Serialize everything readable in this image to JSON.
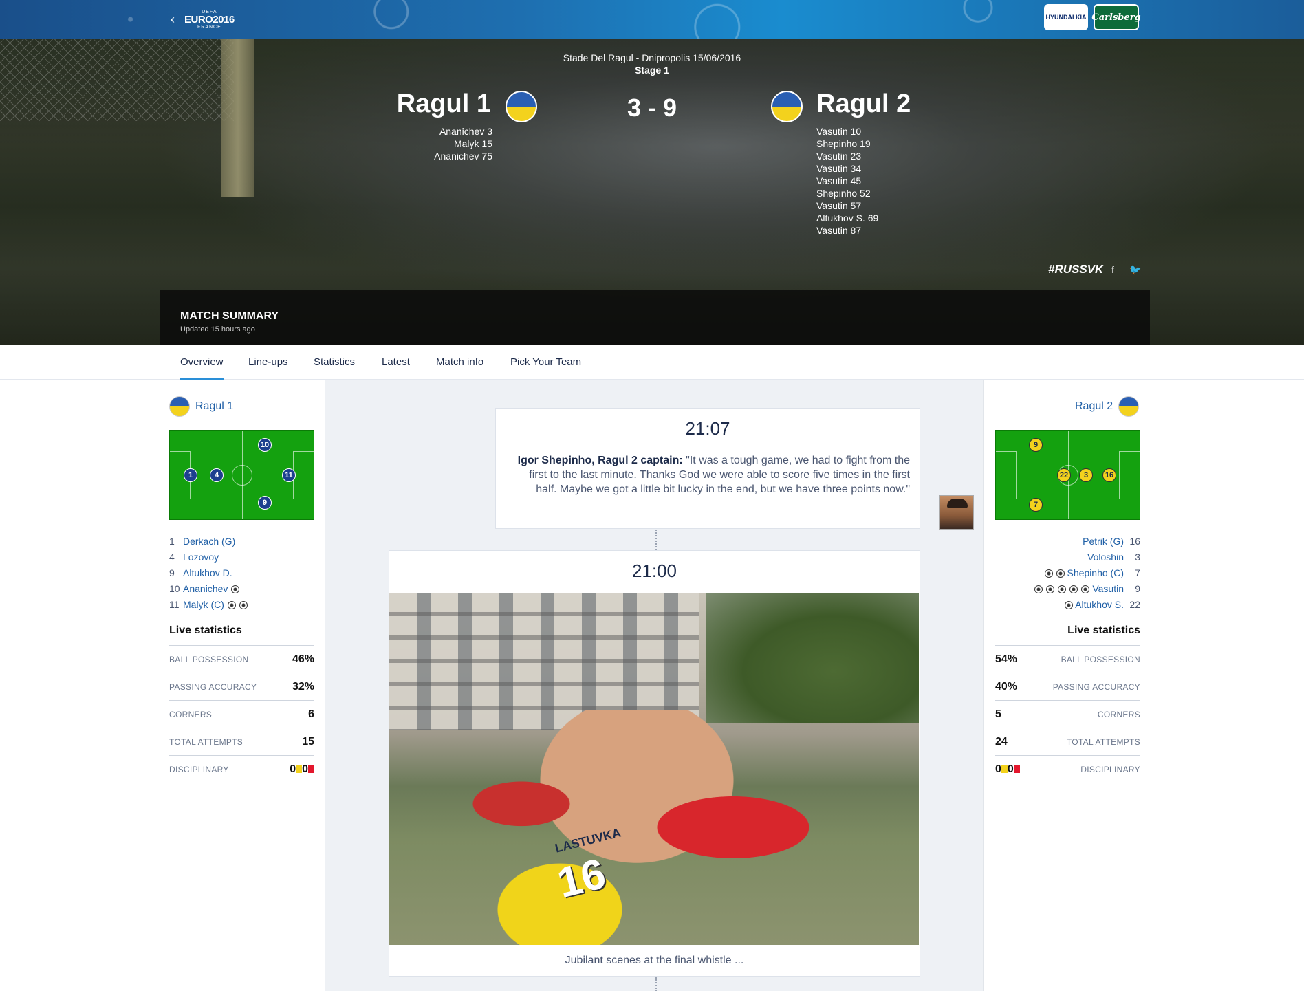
{
  "header": {
    "logo_uefa": "UEFA",
    "logo_euro": "EURO2016",
    "logo_country": "FRANCE",
    "sponsor_1": "HYUNDAI KIA",
    "sponsor_2": "Carlsberg"
  },
  "match": {
    "venue": "Stade Del Ragul - Dnipropolis 15/06/2016",
    "stage": "Stage 1",
    "home_team": "Ragul 1",
    "away_team": "Ragul 2",
    "score": "3 - 9",
    "home_scorers": [
      "Ananichev 3",
      "Malyk 15",
      "Ananichev 75"
    ],
    "away_scorers": [
      "Vasutin 10",
      "Shepinho 19",
      "Vasutin 23",
      "Vasutin 34",
      "Vasutin 45",
      "Shepinho 52",
      "Vasutin 57",
      "Altukhov S. 69",
      "Vasutin 87"
    ],
    "hashtag": "#RUSSVK",
    "flag_colors": [
      "#2a5fb3",
      "#f3d21d"
    ]
  },
  "summary": {
    "title": "MATCH SUMMARY",
    "updated": "Updated 15 hours ago"
  },
  "tabs": [
    "Overview",
    "Line-ups",
    "Statistics",
    "Latest",
    "Match info",
    "Pick Your Team"
  ],
  "home": {
    "name": "Ragul 1",
    "pitch_numbers": [
      "1",
      "4",
      "10",
      "11",
      "9"
    ],
    "lineup": [
      {
        "num": "1",
        "name": "Derkach (G)",
        "goals": 0
      },
      {
        "num": "4",
        "name": "Lozovoy",
        "goals": 0
      },
      {
        "num": "9",
        "name": "Altukhov D.",
        "goals": 0
      },
      {
        "num": "10",
        "name": "Ananichev",
        "goals": 1
      },
      {
        "num": "11",
        "name": "Malyk (C)",
        "goals": 2
      }
    ],
    "live_title": "Live statistics",
    "stats": [
      {
        "label": "BALL POSSESSION",
        "value": "46%"
      },
      {
        "label": "PASSING ACCURACY",
        "value": "32%"
      },
      {
        "label": "CORNERS",
        "value": "6"
      },
      {
        "label": "TOTAL ATTEMPTS",
        "value": "15"
      },
      {
        "label": "DISCIPLINARY",
        "yellow": "0",
        "red": "0"
      }
    ]
  },
  "away": {
    "name": "Ragul 2",
    "pitch_numbers": [
      "9",
      "22",
      "3",
      "16",
      "7"
    ],
    "lineup": [
      {
        "num": "16",
        "name": "Petrik (G)",
        "goals": 0
      },
      {
        "num": "3",
        "name": "Voloshin",
        "goals": 0
      },
      {
        "num": "7",
        "name": "Shepinho (C)",
        "goals": 2
      },
      {
        "num": "9",
        "name": "Vasutin",
        "goals": 5
      },
      {
        "num": "22",
        "name": "Altukhov S.",
        "goals": 1
      }
    ],
    "live_title": "Live statistics",
    "stats": [
      {
        "label": "BALL POSSESSION",
        "value": "54%"
      },
      {
        "label": "PASSING ACCURACY",
        "value": "40%"
      },
      {
        "label": "CORNERS",
        "value": "5"
      },
      {
        "label": "TOTAL ATTEMPTS",
        "value": "24"
      },
      {
        "label": "DISCIPLINARY",
        "yellow": "0",
        "red": "0"
      }
    ]
  },
  "timeline": {
    "quote": {
      "time": "21:07",
      "author": "Igor Shepinho, Ragul 2 captain:",
      "text": "\"It was a tough game, we had to fight from the first to the last minute. Thanks God we were able to score five times in the first half. Maybe we got a little bit lucky in the end, but we have three points now.\""
    },
    "photo": {
      "time": "21:00",
      "jersey_name": "LASTUVKA",
      "jersey_number": "16",
      "caption": "Jubilant scenes at the final whistle ..."
    }
  }
}
